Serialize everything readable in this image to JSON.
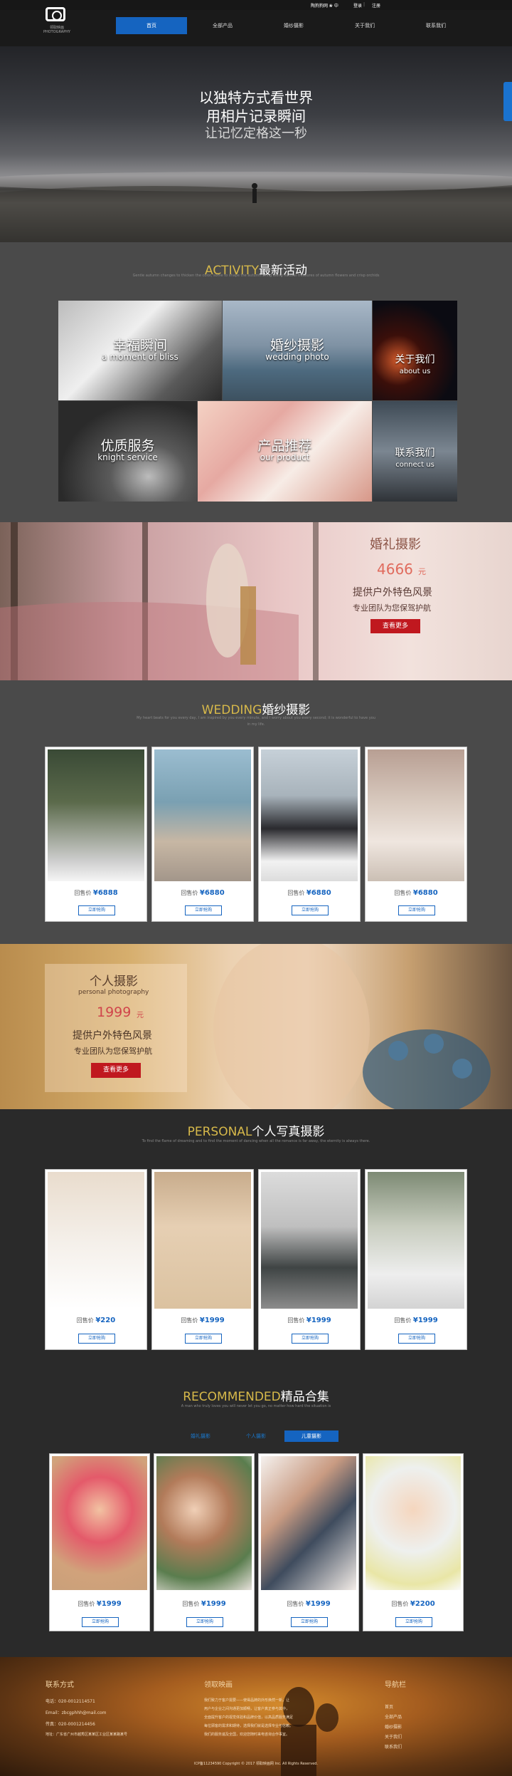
{
  "header": {
    "logo_cn": "领取映画",
    "logo_en": "PHOTOGRAPHY",
    "phone": "陶狗狗网 ❀ 中",
    "login": "登录",
    "register": "注册",
    "nav": [
      "首页",
      "全部产品",
      "婚纱摄影",
      "关于我们",
      "联系我们"
    ]
  },
  "hero": {
    "line1": "以独特方式看世界",
    "line2": "用相片记录瞬间",
    "line3": "让记忆定格这一秒"
  },
  "activity": {
    "title_en": "ACTIVITY",
    "title_cn": "最新活动",
    "subtitle": "Gentle autumn changes to thicken the color, some to shape the autumn bring along natural treasures of autumn flowers and crisp orchids",
    "tiles": [
      {
        "cn": "幸福瞬间",
        "en": "a moment of bliss"
      },
      {
        "cn": "婚纱摄影",
        "en": "wedding photo"
      },
      {
        "cn": "关于我们",
        "en": "about us"
      },
      {
        "cn": "优质服务",
        "en": "knight service"
      },
      {
        "cn": "产品推荐",
        "en": "our product"
      },
      {
        "cn": "联系我们",
        "en": "connect us"
      }
    ]
  },
  "wedding_banner": {
    "title": "婚礼摄影",
    "price": "4666",
    "unit": "元",
    "line1": "提供户外特色风景",
    "line2": "专业团队为您保驾护航",
    "button": "查看更多"
  },
  "wedding": {
    "title_en": "WEDDING",
    "title_cn": "婚纱摄影",
    "subtitle": "My heart beats for you every day, I am inspired by you every minute, and I worry about you every second; it is wonderful to have you in my life.",
    "price_label": "回售价",
    "button": "立即抢购",
    "prices": [
      "¥6888",
      "¥6880",
      "¥6880",
      "¥6880"
    ]
  },
  "personal_banner": {
    "title": "个人摄影",
    "subtitle": "personal photography",
    "price": "1999",
    "unit": "元",
    "line1": "提供户外特色风景",
    "line2": "专业团队为您保驾护航",
    "button": "查看更多"
  },
  "personal": {
    "title_en": "PERSONAL",
    "title_cn": "个人写真摄影",
    "subtitle": "To find the flame of dreaming and to find the moment of dancing when all the romance is far away, the eternity is always there.",
    "price_label": "回售价",
    "button": "立即抢购",
    "prices": [
      "¥220",
      "¥1999",
      "¥1999",
      "¥1999"
    ]
  },
  "recommended": {
    "title_en": "RECOMMENDED",
    "title_cn": "精品合集",
    "subtitle": "A man who truly loves you will never let you go, no matter how hard the situation is",
    "tabs": [
      "婚礼摄影",
      "个人摄影",
      "儿童摄影"
    ],
    "price_label": "回售价",
    "button": "立即抢购",
    "prices": [
      "¥1999",
      "¥1999",
      "¥1999",
      "¥2200"
    ]
  },
  "footer": {
    "contact_title": "联系方式",
    "contact_lines": [
      "电话：020-0012114571",
      "Email：zbcgphhh@mail.com",
      "传真：020-0001214456",
      "地址：广东省广州市越秀区某某区工业区某某路某号"
    ],
    "about_title": "领取映画",
    "about_lines": [
      "我们致力于客户需要——使得品牌的外形焕然一新，让",
      "用户与企业之间沟通更加顺畅，让客户真正参与其中，",
      "全面提升客户的视觉体验和品牌价值，以高品质服务满足",
      "每位顾客的需求和期待，选择我们就是选择专业与信赖。",
      "我们的服务遍及全国，欢迎您随时来电咨询合作事宜。"
    ],
    "nav_title": "导航栏",
    "nav_items": [
      "首页",
      "全部产品",
      "婚纱摄影",
      "关于我们",
      "联系我们"
    ],
    "copyright": "ICP备11234590 Copyright © 2017 领取映画网 Inc. All Rights Reserved."
  }
}
